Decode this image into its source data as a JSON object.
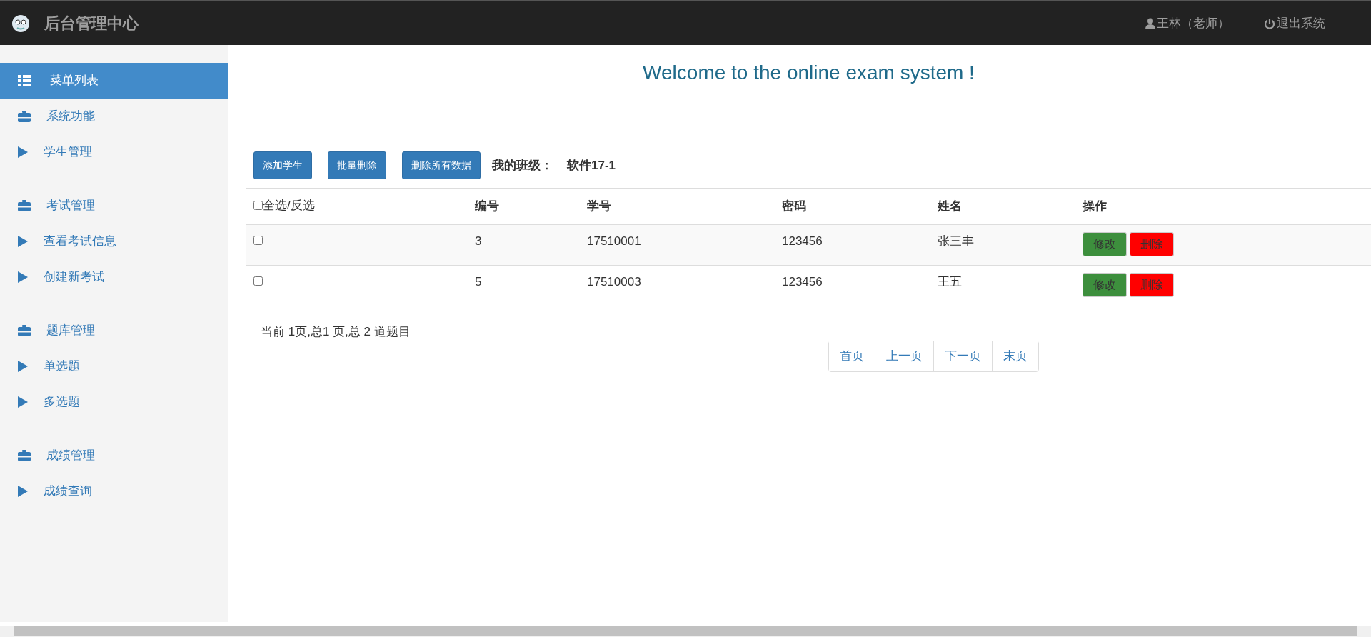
{
  "navbar": {
    "brand": "后台管理中心",
    "user": "王林（老师）",
    "logout": "退出系统"
  },
  "sidebar": {
    "groups": [
      {
        "items": [
          {
            "kind": "header",
            "label": "菜单列表",
            "selected": true
          },
          {
            "kind": "section",
            "label": "系统功能",
            "selected": false
          },
          {
            "kind": "link",
            "label": "学生管理",
            "selected": false
          }
        ]
      },
      {
        "items": [
          {
            "kind": "section",
            "label": "考试管理",
            "selected": false
          },
          {
            "kind": "link",
            "label": "查看考试信息",
            "selected": false
          },
          {
            "kind": "link",
            "label": "创建新考试",
            "selected": false
          }
        ]
      },
      {
        "items": [
          {
            "kind": "section",
            "label": "题库管理",
            "selected": false
          },
          {
            "kind": "link",
            "label": "单选题",
            "selected": false
          },
          {
            "kind": "link",
            "label": "多选题",
            "selected": false
          }
        ]
      },
      {
        "items": [
          {
            "kind": "section",
            "label": "成绩管理",
            "selected": false
          },
          {
            "kind": "link",
            "label": "成绩查询",
            "selected": false
          }
        ]
      }
    ]
  },
  "main": {
    "title": "Welcome to the online exam system !",
    "toolbar": {
      "buttons": [
        "添加学生",
        "批量删除",
        "删除所有数据"
      ],
      "class_label": "我的班级：",
      "class_value": "软件17-1"
    },
    "table": {
      "select_all": {
        "label": "全选/反选",
        "checked": false
      },
      "columns": [
        "编号",
        "学号",
        "密码",
        "姓名",
        "操作"
      ],
      "rows": [
        {
          "checked": false,
          "cells": [
            "3",
            "17510001",
            "123456",
            "张三丰"
          ],
          "actions": [
            "修改",
            "删除"
          ]
        },
        {
          "checked": false,
          "cells": [
            "5",
            "17510003",
            "123456",
            "王五"
          ],
          "actions": [
            "修改",
            "删除"
          ]
        }
      ]
    },
    "page_info": "当前 1页,总1 页,总 2 道题目",
    "pagination": [
      "首页",
      "上一页",
      "下一页",
      "末页"
    ]
  }
}
